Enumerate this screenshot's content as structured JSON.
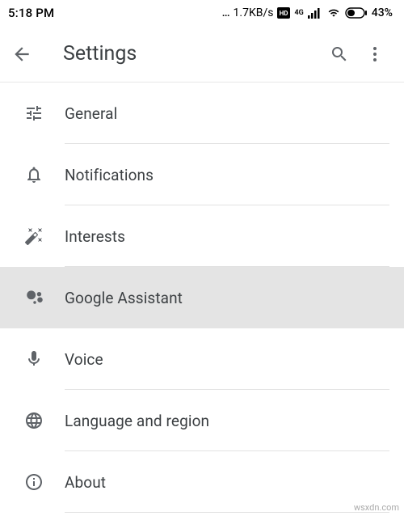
{
  "status": {
    "time": "5:18 PM",
    "net_speed": "1.7KB/s",
    "network_indicator": "4G",
    "battery_percent": "43%"
  },
  "appbar": {
    "title": "Settings"
  },
  "items": [
    {
      "label": "General"
    },
    {
      "label": "Notifications"
    },
    {
      "label": "Interests"
    },
    {
      "label": "Google Assistant"
    },
    {
      "label": "Voice"
    },
    {
      "label": "Language and region"
    },
    {
      "label": "About"
    }
  ],
  "watermark": "wsxdn.com"
}
